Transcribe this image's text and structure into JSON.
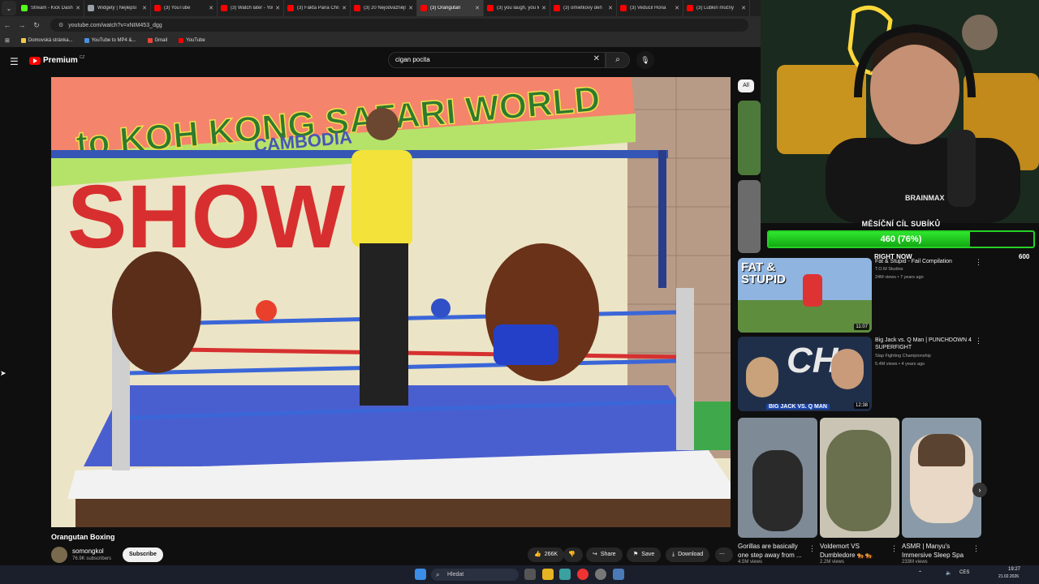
{
  "browser": {
    "tabs": [
      {
        "title": "Stream - Kick Dashboard",
        "color": "#53fc18",
        "active": false
      },
      {
        "title": "Widgety | Nejlepší",
        "color": "#9aa0a6",
        "active": false
      },
      {
        "title": "(3) YouTube",
        "color": "#ff0000",
        "active": false
      },
      {
        "title": "(3) Watch later - YouTube",
        "color": "#ff0000",
        "active": false
      },
      {
        "title": "(3) Fakta Pana Chrapka",
        "color": "#ff0000",
        "active": false
      },
      {
        "title": "(3) 20 Nejodvážnějších",
        "color": "#ff0000",
        "active": false
      },
      {
        "title": "(3) Orangutan",
        "color": "#ff0000",
        "active": true
      },
      {
        "title": "(3) you laugh, you lose",
        "color": "#ff0000",
        "active": false
      },
      {
        "title": "(3) omietkovy deň",
        "color": "#ff0000",
        "active": false
      },
      {
        "title": "(3) Veducil Horia",
        "color": "#ff0000",
        "active": false
      },
      {
        "title": "(3) Lubkin múčny",
        "color": "#ff0000",
        "active": false
      }
    ],
    "url": "youtube.com/watch?v=xNIM453_dgg",
    "bookmarks": [
      {
        "label": "Domovská stránka...",
        "color": "#f2c94c"
      },
      {
        "label": "YouTube to MP4 &...",
        "color": "#4a90e2"
      },
      {
        "label": "Gmail",
        "color": "#ea4335"
      },
      {
        "label": "YouTube",
        "color": "#ff0000"
      }
    ]
  },
  "youtube": {
    "logo": "Premium",
    "logo_country": "CZ",
    "search_query": "cigan pocita",
    "chip_all": "All",
    "video": {
      "title": "Orangutan Boxing",
      "banner_text": "to KOH KONG SAFARI WORLD",
      "banner_sub": "CAMBODIA",
      "wall_text": "SHOW",
      "channel": "somongkol",
      "subscribers": "76.9K subscribers",
      "subscribe_label": "Subscribe",
      "likes": "266K",
      "share_label": "Share",
      "save_label": "Save",
      "download_label": "Download"
    },
    "recommendations": [
      {
        "title": "Fat & Stupid - Fail Compilation",
        "channel": "T.O.M Studios",
        "meta": "24M views • 7 years ago",
        "duration": "11:07",
        "thumb_text": "FAT & STUPID"
      },
      {
        "title": "Big Jack vs. Q Man | PUNCHDOWN 4 SUPERFIGHT",
        "channel": "Slap Fighting Championship",
        "meta": "5.4M views • 4 years ago",
        "duration": "12:38",
        "thumb_text": "BIG JACK VS. Q MAN"
      }
    ],
    "shorts": [
      {
        "title": "Gorillas are basically one step away from ...",
        "views": "4.5M views"
      },
      {
        "title": "Voldemort VS Dumbledore 🐅🐅",
        "views": "2.2M views"
      },
      {
        "title": "ASMR | Manyu's Immersive Sleep Spa",
        "views": "233M views"
      }
    ]
  },
  "overlay": {
    "goal_title": "MĚSÍČNÍ CÍL SUBÍKŮ",
    "goal_label": "460 (76%)",
    "goal_fraction": 0.76,
    "goal_now": "RIGHT NOW",
    "goal_target": "600",
    "shirt_text": "BRAINMAX"
  },
  "taskbar": {
    "search_placeholder": "Hledat",
    "lang": "CES",
    "time": "19:27",
    "date": "21.02.2026"
  }
}
